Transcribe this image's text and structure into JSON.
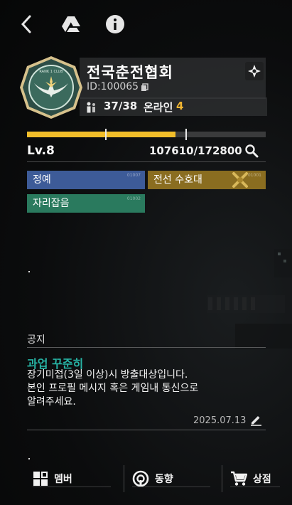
{
  "header": {
    "icons": [
      "back-icon",
      "google-drive-icon",
      "info-icon"
    ]
  },
  "club": {
    "name": "전국춘전협회",
    "id_text": "ID:100065",
    "member_count": "37/38",
    "online_label": "온라인",
    "online_count": "4",
    "emblem_text": "RANK 1 CLUB"
  },
  "level": {
    "label": "Lv.8",
    "xp_text": "107610/172800",
    "progress_fraction": 0.623
  },
  "tags": [
    {
      "label": "정예",
      "code": "01007"
    },
    {
      "label": "전선 수호대",
      "code": "01001"
    },
    {
      "label": "자리잡음",
      "code": "01002"
    }
  ],
  "notice": {
    "heading": "공지",
    "title": "과업 꾸준히",
    "lines": [
      "장기미접(3일 이상)시 방출대상입니다.",
      "본인 프로필 메시지 혹은 게임내 통신으로",
      "알려주세요."
    ],
    "date": "2025.07.13"
  },
  "nav": {
    "members": "멤버",
    "activity": "동향",
    "shop": "상점"
  },
  "colors": {
    "accent_yellow": "#f2be2a",
    "online_orange": "#f3b631",
    "notice_teal": "#27b5a6",
    "tag_blue": "#3d5b98",
    "tag_gold": "#8a6d20",
    "tag_teal": "#2a7a5e"
  }
}
